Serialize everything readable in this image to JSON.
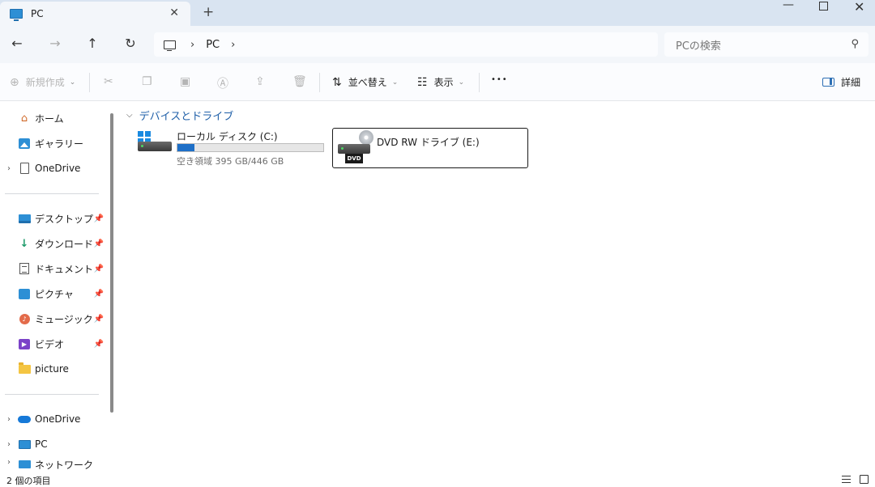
{
  "window": {
    "tab_title": "PC",
    "tab_close": "✕",
    "new_tab": "+",
    "minimize": "—",
    "close": "✕"
  },
  "navigation": {
    "back": "←",
    "forward": "→",
    "up": "↑",
    "refresh": "↻",
    "breadcrumb": [
      "PC"
    ],
    "search_placeholder": "PCの検索"
  },
  "toolbar": {
    "new_label": "新規作成",
    "sort_label": "並べ替え",
    "view_label": "表示",
    "more_label": "•••",
    "details_label": "詳細"
  },
  "sidebar": {
    "home": "ホーム",
    "gallery": "ギャラリー",
    "onedrive_top": "OneDrive",
    "desktop": "デスクトップ",
    "downloads": "ダウンロード",
    "documents": "ドキュメント",
    "pictures": "ピクチャ",
    "music": "ミュージック",
    "videos": "ビデオ",
    "picture_folder": "picture",
    "onedrive": "OneDrive",
    "pc": "PC",
    "network": "ネットワーク"
  },
  "content": {
    "group_title": "デバイスとドライブ",
    "drives": [
      {
        "name": "ローカル ディスク (C:)",
        "free_text": "空き領域 395 GB/446 GB",
        "used_fraction": 0.114
      },
      {
        "name": "DVD RW ドライブ (E:)",
        "badge": "DVD"
      }
    ]
  },
  "status": {
    "item_count": "2 個の項目"
  },
  "colors": {
    "accent": "#1e6fc7",
    "tabbar": "#d9e4f1",
    "group_title": "#1f5fa8"
  }
}
